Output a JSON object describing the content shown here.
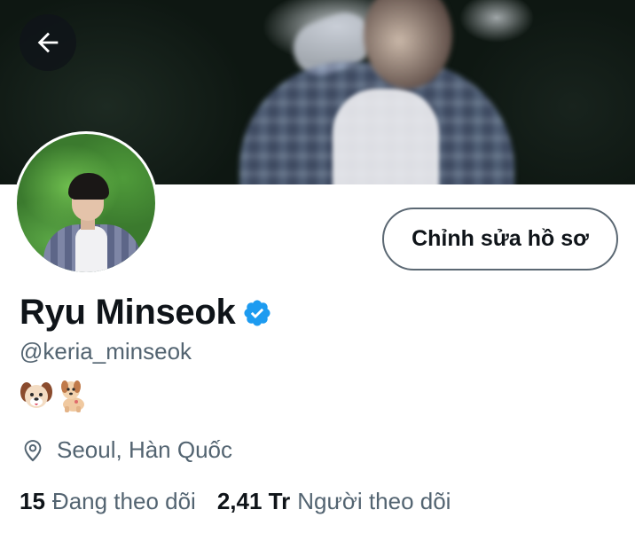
{
  "header": {
    "back_icon": "arrow-left-icon"
  },
  "profile": {
    "display_name": "Ryu Minseok",
    "verified_icon": "verified-badge-icon",
    "handle": "@keria_minseok",
    "bio_emojis": [
      "dog-face-emoji",
      "dog-emoji"
    ],
    "location": "Seoul, Hàn Quốc",
    "location_icon": "location-pin-icon",
    "edit_button_label": "Chỉnh sửa hồ sơ"
  },
  "stats": {
    "following_count": "15",
    "following_label": "Đang theo dõi",
    "followers_count": "2,41 Tr",
    "followers_label": "Người theo dõi"
  },
  "colors": {
    "primary_text": "#0f1419",
    "secondary_text": "#536471",
    "verified_blue": "#1d9bf0",
    "button_border": "#5b6873"
  }
}
